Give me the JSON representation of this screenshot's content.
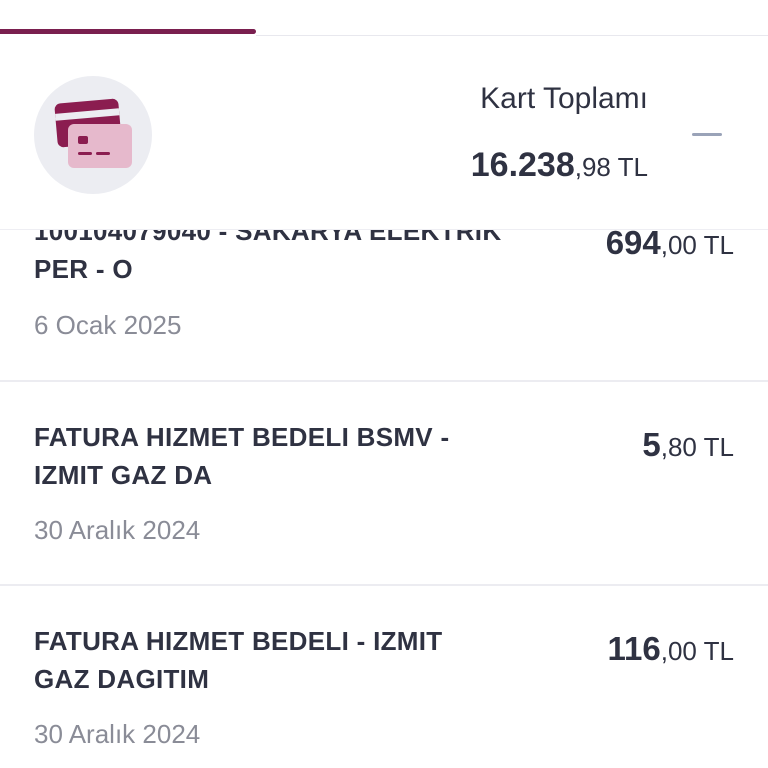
{
  "summary": {
    "label": "Kart Toplamı",
    "amount_int": "16.238",
    "amount_dec": ",98 TL"
  },
  "transactions": [
    {
      "title": "100104079040 - SAKARYA ELEKTRIK PER - O",
      "date": "6 Ocak 2025",
      "amount_int": "694",
      "amount_dec": ",00 TL"
    },
    {
      "title": "FATURA HIZMET BEDELI BSMV - IZMIT GAZ DA",
      "date": "30 Aralık 2024",
      "amount_int": "5",
      "amount_dec": ",80 TL"
    },
    {
      "title": "FATURA HIZMET BEDELI - IZMIT GAZ DAGITIM",
      "date": "30 Aralık 2024",
      "amount_int": "116",
      "amount_dec": ",00 TL"
    }
  ],
  "icons": {
    "card": "credit-cards-icon",
    "collapse": "minus-icon"
  },
  "colors": {
    "accent": "#7a1f4f",
    "card_light": "#e6b9cc",
    "muted_text": "#8a8c97"
  }
}
